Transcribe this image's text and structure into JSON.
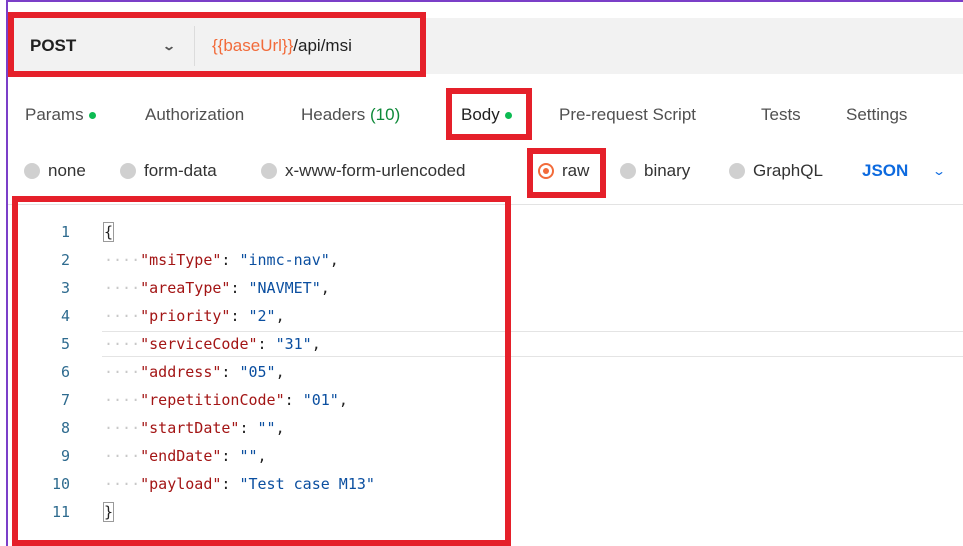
{
  "request": {
    "method": "POST",
    "url_variable": "{{baseUrl}}",
    "url_path": "/api/msi"
  },
  "tabs": [
    {
      "label": "Params",
      "dot": true
    },
    {
      "label": "Authorization"
    },
    {
      "label": "Headers",
      "count": "(10)"
    },
    {
      "label": "Body",
      "dot": true,
      "active": true
    },
    {
      "label": "Pre-request Script"
    },
    {
      "label": "Tests"
    },
    {
      "label": "Settings"
    }
  ],
  "body_types": [
    "none",
    "form-data",
    "x-www-form-urlencoded",
    "raw",
    "binary",
    "GraphQL"
  ],
  "selected_body_type": "raw",
  "format": "JSON",
  "editor": {
    "line_numbers": [
      "1",
      "2",
      "3",
      "4",
      "5",
      "6",
      "7",
      "8",
      "9",
      "10",
      "11"
    ],
    "current_line": 5,
    "open_brace": "{",
    "close_brace": "}",
    "fields": [
      {
        "key": "\"msiType\"",
        "sep": ": ",
        "value": "\"inmc-nav\"",
        "comma": ","
      },
      {
        "key": "\"areaType\"",
        "sep": ": ",
        "value": "\"NAVMET\"",
        "comma": ","
      },
      {
        "key": "\"priority\"",
        "sep": ": ",
        "value": "\"2\"",
        "comma": ","
      },
      {
        "key": "\"serviceCode\"",
        "sep": ": ",
        "value": "\"31\"",
        "comma": ","
      },
      {
        "key": "\"address\"",
        "sep": ": ",
        "value": "\"05\"",
        "comma": ","
      },
      {
        "key": "\"repetitionCode\"",
        "sep": ": ",
        "value": "\"01\"",
        "comma": ","
      },
      {
        "key": "\"startDate\"",
        "sep": ": ",
        "value": "\"\"",
        "comma": ","
      },
      {
        "key": "\"endDate\"",
        "sep": ": ",
        "value": "\"\"",
        "comma": ","
      },
      {
        "key": "\"payload\"",
        "sep": ": ",
        "value": "\"Test case M13\"",
        "comma": ""
      }
    ]
  },
  "colors": {
    "accent": "#f26b3a",
    "highlight": "#e5202a",
    "active_dot": "#0cbb52",
    "link": "#0d6adf"
  }
}
